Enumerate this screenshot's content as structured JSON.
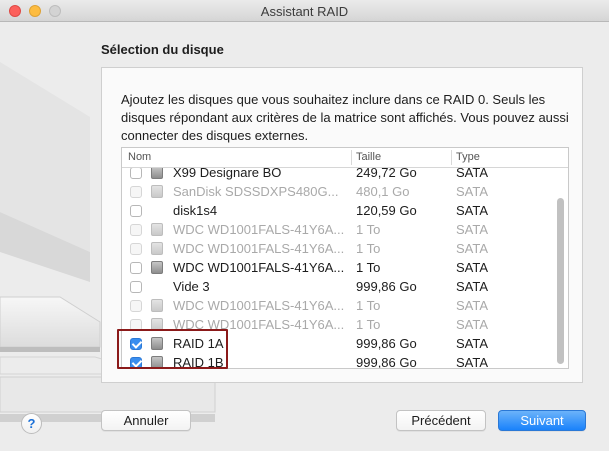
{
  "window": {
    "title": "Assistant RAID"
  },
  "section_title": "Sélection du disque",
  "description": "Ajoutez les disques que vous souhaitez inclure dans ce RAID 0. Seuls les disques répondant aux critères de la matrice sont affichés. Vous pouvez aussi connecter des disques externes.",
  "table": {
    "columns": {
      "name": "Nom",
      "size": "Taille",
      "type": "Type"
    },
    "rows": [
      {
        "name": "X99 Designare BO",
        "size": "249,72 Go",
        "type": "SATA",
        "checked": false,
        "enabled": true,
        "icon": "drive-icon",
        "partial": true
      },
      {
        "name": "SanDisk SDSSDXPS480G...",
        "size": "480,1 Go",
        "type": "SATA",
        "checked": false,
        "enabled": false,
        "icon": "drive-icon"
      },
      {
        "name": "disk1s4",
        "size": "120,59 Go",
        "type": "SATA",
        "checked": false,
        "enabled": true,
        "icon": "none"
      },
      {
        "name": "WDC WD1001FALS-41Y6A...",
        "size": "1 To",
        "type": "SATA",
        "checked": false,
        "enabled": false,
        "icon": "drive-icon"
      },
      {
        "name": "WDC WD1001FALS-41Y6A...",
        "size": "1 To",
        "type": "SATA",
        "checked": false,
        "enabled": false,
        "icon": "drive-icon"
      },
      {
        "name": "WDC WD1001FALS-41Y6A...",
        "size": "1 To",
        "type": "SATA",
        "checked": false,
        "enabled": true,
        "icon": "drive-icon"
      },
      {
        "name": "Vide 3",
        "size": "999,86 Go",
        "type": "SATA",
        "checked": false,
        "enabled": true,
        "icon": "none"
      },
      {
        "name": "WDC WD1001FALS-41Y6A...",
        "size": "1 To",
        "type": "SATA",
        "checked": false,
        "enabled": false,
        "icon": "drive-icon"
      },
      {
        "name": "WDC WD1001FALS-41Y6A...",
        "size": "1 To",
        "type": "SATA",
        "checked": false,
        "enabled": false,
        "icon": "drive-icon"
      },
      {
        "name": "RAID 1A",
        "size": "999,86 Go",
        "type": "SATA",
        "checked": true,
        "enabled": true,
        "icon": "drive-icon"
      },
      {
        "name": "RAID 1B",
        "size": "999,86 Go",
        "type": "SATA",
        "checked": true,
        "enabled": true,
        "icon": "drive-icon"
      }
    ]
  },
  "buttons": {
    "help": "?",
    "cancel": "Annuler",
    "previous": "Précédent",
    "next": "Suivant"
  },
  "colors": {
    "accent": "#1a82fb",
    "highlight_border": "#8b1a1a"
  }
}
